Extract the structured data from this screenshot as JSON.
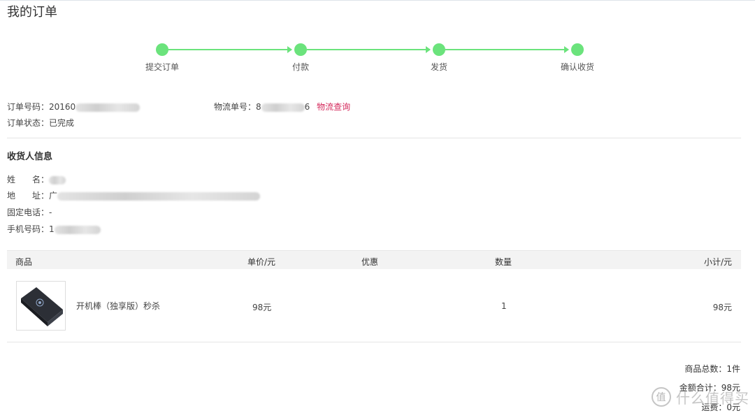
{
  "page": {
    "title": "我的订单"
  },
  "progress": {
    "steps": [
      {
        "label": "提交订单"
      },
      {
        "label": "付款"
      },
      {
        "label": "发货"
      },
      {
        "label": "确认收货"
      }
    ],
    "color": "#6be37c"
  },
  "order": {
    "number_label": "订单号码：",
    "number_prefix": "20160",
    "number_suffix": "",
    "logistics_label": "物流单号：",
    "logistics_prefix": "8",
    "logistics_suffix": "6",
    "logistics_link": "物流查询",
    "status_label": "订单状态：",
    "status_value": "已完成"
  },
  "receiver": {
    "section_title": "收货人信息",
    "name_label": "姓　　名：",
    "address_label": "地　　址：",
    "address_prefix": "广",
    "phone_label": "固定电话：",
    "phone_value": "-",
    "mobile_label": "手机号码：",
    "mobile_prefix": "1"
  },
  "table": {
    "headers": {
      "product": "商品",
      "unit_price": "单价/元",
      "discount": "优惠",
      "quantity": "数量",
      "subtotal": "小计/元"
    },
    "rows": [
      {
        "product": "开机棒（独享版）秒杀",
        "unit_price": "98元",
        "discount": "",
        "quantity": "1",
        "subtotal": "98元"
      }
    ]
  },
  "summary": {
    "total_items": "商品总数：1件",
    "total_amount": "金额合计：98元",
    "shipping": "运费：0元"
  },
  "watermark": {
    "text": "什么值得买"
  },
  "colors": {
    "accent": "#6be37c",
    "link": "#d42a5c"
  }
}
